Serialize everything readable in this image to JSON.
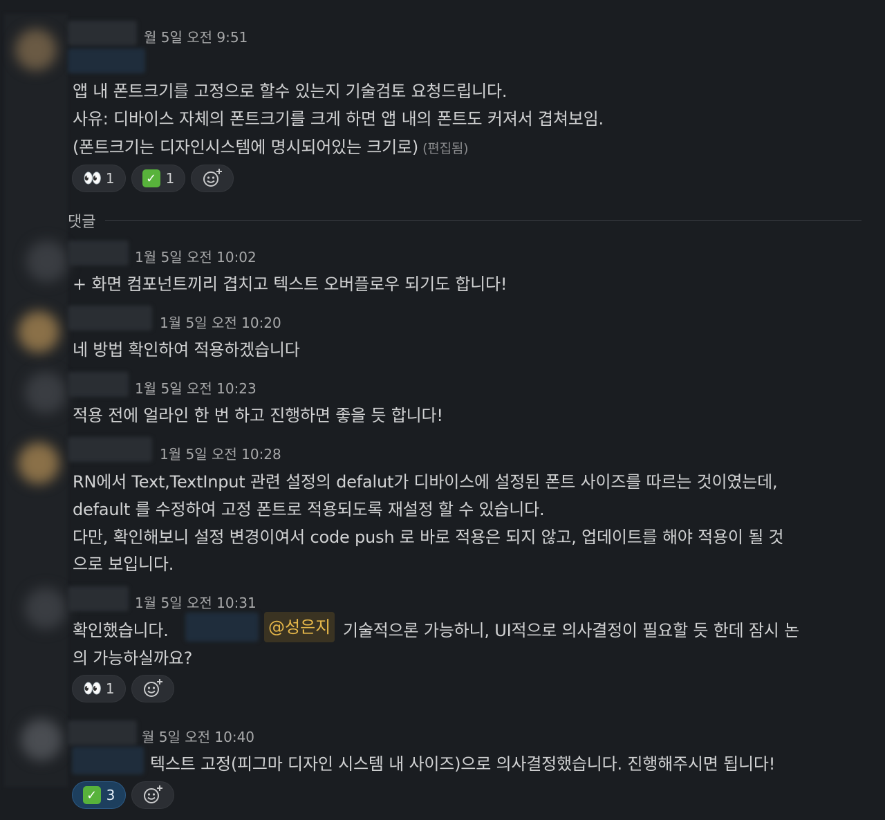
{
  "messages": [
    {
      "timestamp": "월 5일 오전 9:51",
      "lines": [
        "앱 내 폰트크기를 고정으로 할수 있는지 기술검토 요청드립니다.",
        "사유: 디바이스 자체의 폰트크기를 크게 하면 앱 내의 폰트도 커져서 겹쳐보임.",
        "(폰트크기는 디자인시스템에 명시되어있는 크기로)"
      ],
      "edited_label": "(편집됨)",
      "reactions": [
        {
          "emoji": "eyes",
          "count": "1"
        },
        {
          "emoji": "white-check-mark",
          "count": "1"
        }
      ]
    },
    {
      "timestamp": "1월 5일 오전 10:02",
      "lines": [
        "+ 화면 컴포넌트끼리 겹치고 텍스트 오버플로우 되기도 합니다!"
      ]
    },
    {
      "timestamp": "1월 5일 오전 10:20",
      "lines": [
        "네 방법 확인하여 적용하겠습니다"
      ]
    },
    {
      "timestamp": "1월 5일 오전 10:23",
      "lines": [
        "적용 전에 얼라인 한 번 하고 진행하면 좋을 듯 합니다!"
      ]
    },
    {
      "timestamp": "1월 5일 오전 10:28",
      "lines": [
        "RN에서 Text,TextInput 관련 설정의 defalut가 디바이스에 설정된 폰트 사이즈를 따르는 것이였는데,",
        "default 를 수정하여 고정 폰트로 적용되도록 재설정 할 수 있습니다.",
        "다만, 확인해보니 설정 변경이여서 code push 로 바로 적용은 되지 않고, 업데이트를 해야 적용이 될 것",
        "으로 보입니다."
      ]
    },
    {
      "timestamp": "1월 5일 오전 10:31",
      "line1_prefix": "확인했습니다.",
      "mention": "@성은지",
      "line1_suffix": "기술적으론 가능하니, UI적으로 의사결정이 필요할 듯 한데 잠시 논",
      "line2": "의 가능하실까요?",
      "reactions": [
        {
          "emoji": "eyes",
          "count": "1"
        }
      ]
    },
    {
      "timestamp": "월 5일 오전 10:40",
      "lines": [
        "텍스트 고정(피그마 디자인 시스템 내 사이즈)으로 의사결정했습니다. 진행해주시면 됩니다!"
      ],
      "reactions": [
        {
          "emoji": "white-check-mark",
          "count": "3",
          "active": true
        }
      ]
    }
  ],
  "thread_divider_label": "댓글",
  "add_reaction_icon": "add-emoji-icon",
  "colors": {
    "background": "#1a1d21",
    "text": "#d1d2d3",
    "timestamp": "#a9aaab",
    "mention_bg": "#3a3322",
    "mention_text": "#e8b94a",
    "active_reaction": "#1d3f5e",
    "check_green": "#58b33b"
  }
}
